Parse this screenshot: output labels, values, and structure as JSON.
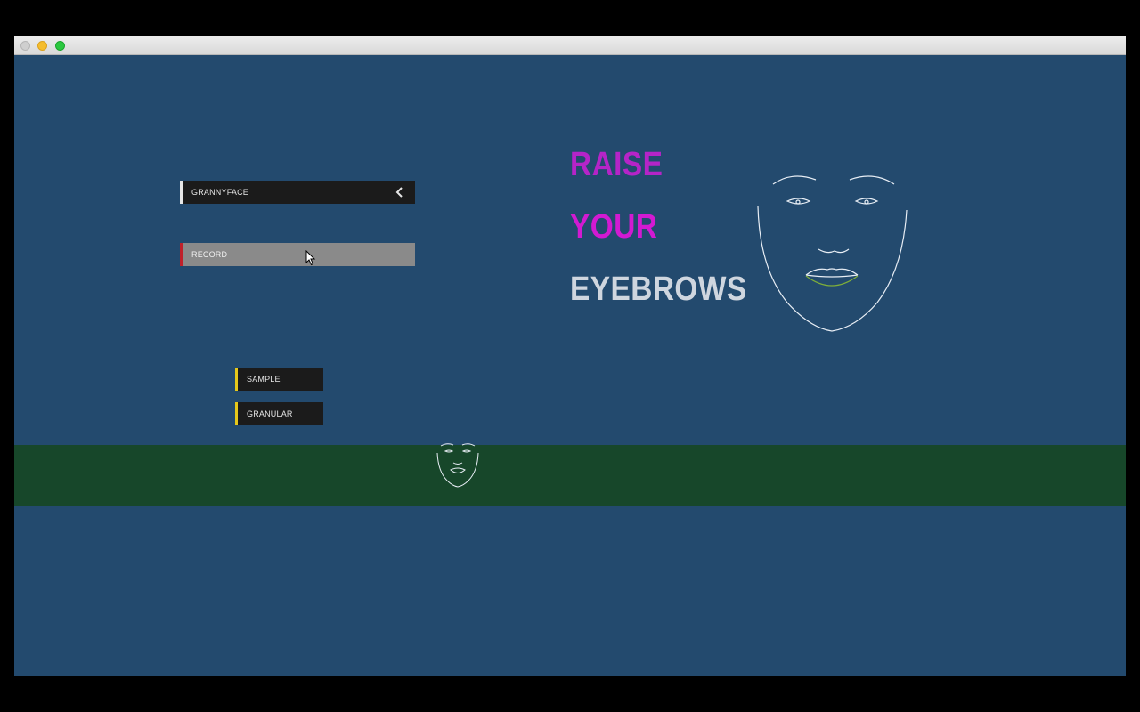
{
  "window": {
    "traffic_lights": [
      "close",
      "minimize",
      "maximize"
    ]
  },
  "controls": {
    "grannyface_label": "GRANNYFACE",
    "record_label": "RECORD",
    "sample_label": "SAMPLE",
    "granular_label": "GRANULAR"
  },
  "prompt": {
    "line1": "RAISE",
    "line2": "YOUR",
    "line3": "EYEBROWS"
  },
  "icons": {
    "dropdown_toggle": "chevron-left-icon",
    "face_preview": "face-outline-icon",
    "face_thumbnail": "face-outline-icon",
    "pointer": "mouse-cursor-icon"
  },
  "colors": {
    "background": "#234a6e",
    "band": "#17472a",
    "word_raise": "#b524c8",
    "word_your": "#d21ad2",
    "word_eyebrows": "#cfd6df",
    "record_accent": "#c0202a",
    "sample_accent": "#e6c81a"
  }
}
